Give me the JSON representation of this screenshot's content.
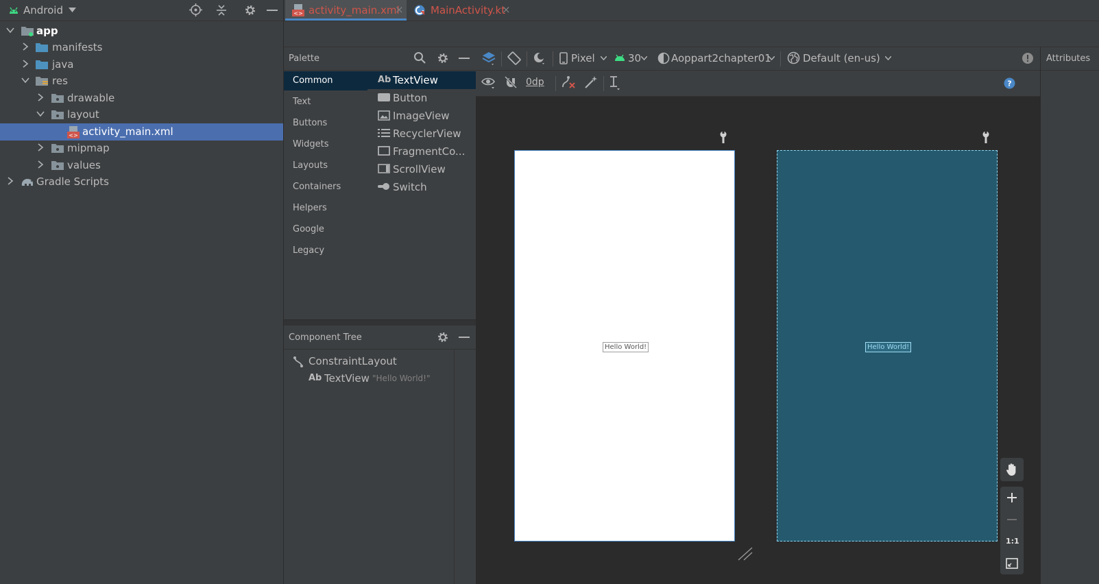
{
  "project": {
    "view_name": "Android",
    "tree": [
      {
        "label": "app"
      },
      {
        "label": "manifests"
      },
      {
        "label": "java"
      },
      {
        "label": "res"
      },
      {
        "label": "drawable"
      },
      {
        "label": "layout"
      },
      {
        "label": "activity_main.xml"
      },
      {
        "label": "mipmap"
      },
      {
        "label": "values"
      },
      {
        "label": "Gradle Scripts"
      }
    ]
  },
  "tabs": [
    {
      "label": "activity_main.xml",
      "close": "×"
    },
    {
      "label": "MainActivity.kt",
      "close": "×"
    }
  ],
  "palette": {
    "title": "Palette",
    "categories": [
      "Common",
      "Text",
      "Buttons",
      "Widgets",
      "Layouts",
      "Containers",
      "Helpers",
      "Google",
      "Legacy"
    ],
    "widgets": [
      "TextView",
      "Button",
      "ImageView",
      "RecyclerView",
      "FragmentCo...",
      "ScrollView",
      "Switch"
    ],
    "textview_icon_text": "Ab"
  },
  "component_tree": {
    "title": "Component Tree",
    "root": "ConstraintLayout",
    "child": "TextView",
    "child_icon_text": "Ab",
    "child_value": "\"Hello World!\""
  },
  "design_toolbar": {
    "device": "Pixel",
    "api": "30",
    "theme": "Aoppart2chapter01",
    "locale": "Default (en-us)",
    "margin": "0dp"
  },
  "attributes": {
    "title": "Attributes"
  },
  "canvas": {
    "hello_text": "Hello World!"
  },
  "zoom": {
    "fit_label": "1:1"
  },
  "colors": {
    "accent": "#4a88c7",
    "selection": "#4b6eaf",
    "android_green": "#3ddc84",
    "blueprint": "#255a6e"
  }
}
